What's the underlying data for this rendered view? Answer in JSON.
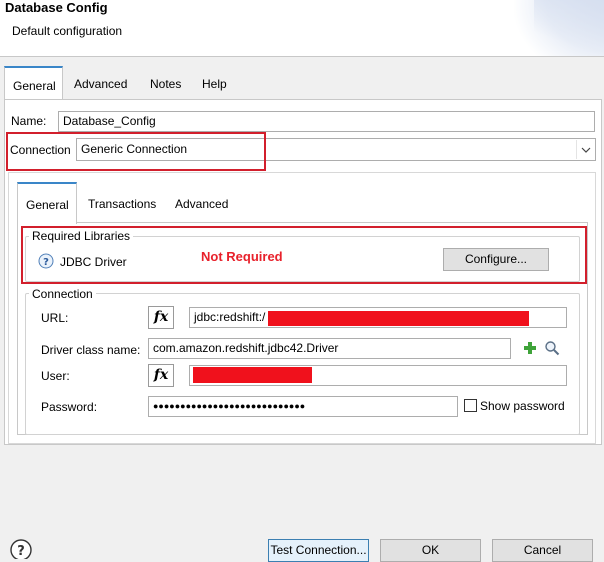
{
  "header": {
    "title": "Database Config",
    "subtitle": "Default configuration"
  },
  "outer_tabs": [
    "General",
    "Advanced",
    "Notes",
    "Help"
  ],
  "form": {
    "name_label": "Name:",
    "name_value": "Database_Config",
    "connection_label": "Connection",
    "connection_value": "Generic Connection"
  },
  "inner_tabs": [
    "General",
    "Transactions",
    "Advanced"
  ],
  "required_libraries": {
    "title": "Required Libraries",
    "driver_label": "JDBC Driver",
    "status": "Not Required",
    "configure_button": "Configure..."
  },
  "connection_group": {
    "title": "Connection",
    "url_label": "URL:",
    "url_value": "jdbc:redshift:/",
    "driver_class_label": "Driver class name:",
    "driver_class_value": "com.amazon.redshift.jdbc42.Driver",
    "user_label": "User:",
    "password_label": "Password:",
    "password_value": "●●●●●●●●●●●●●●●●●●●●●●●●●●●●",
    "show_password_label": "Show password",
    "fx_label": "fx"
  },
  "footer": {
    "test_connection": "Test Connection...",
    "ok": "OK",
    "cancel": "Cancel"
  },
  "colors": {
    "highlight_red": "#d21f2c",
    "status_red": "#e8212b",
    "tab_accent": "#3a86c8",
    "redaction": "#f0111c"
  }
}
